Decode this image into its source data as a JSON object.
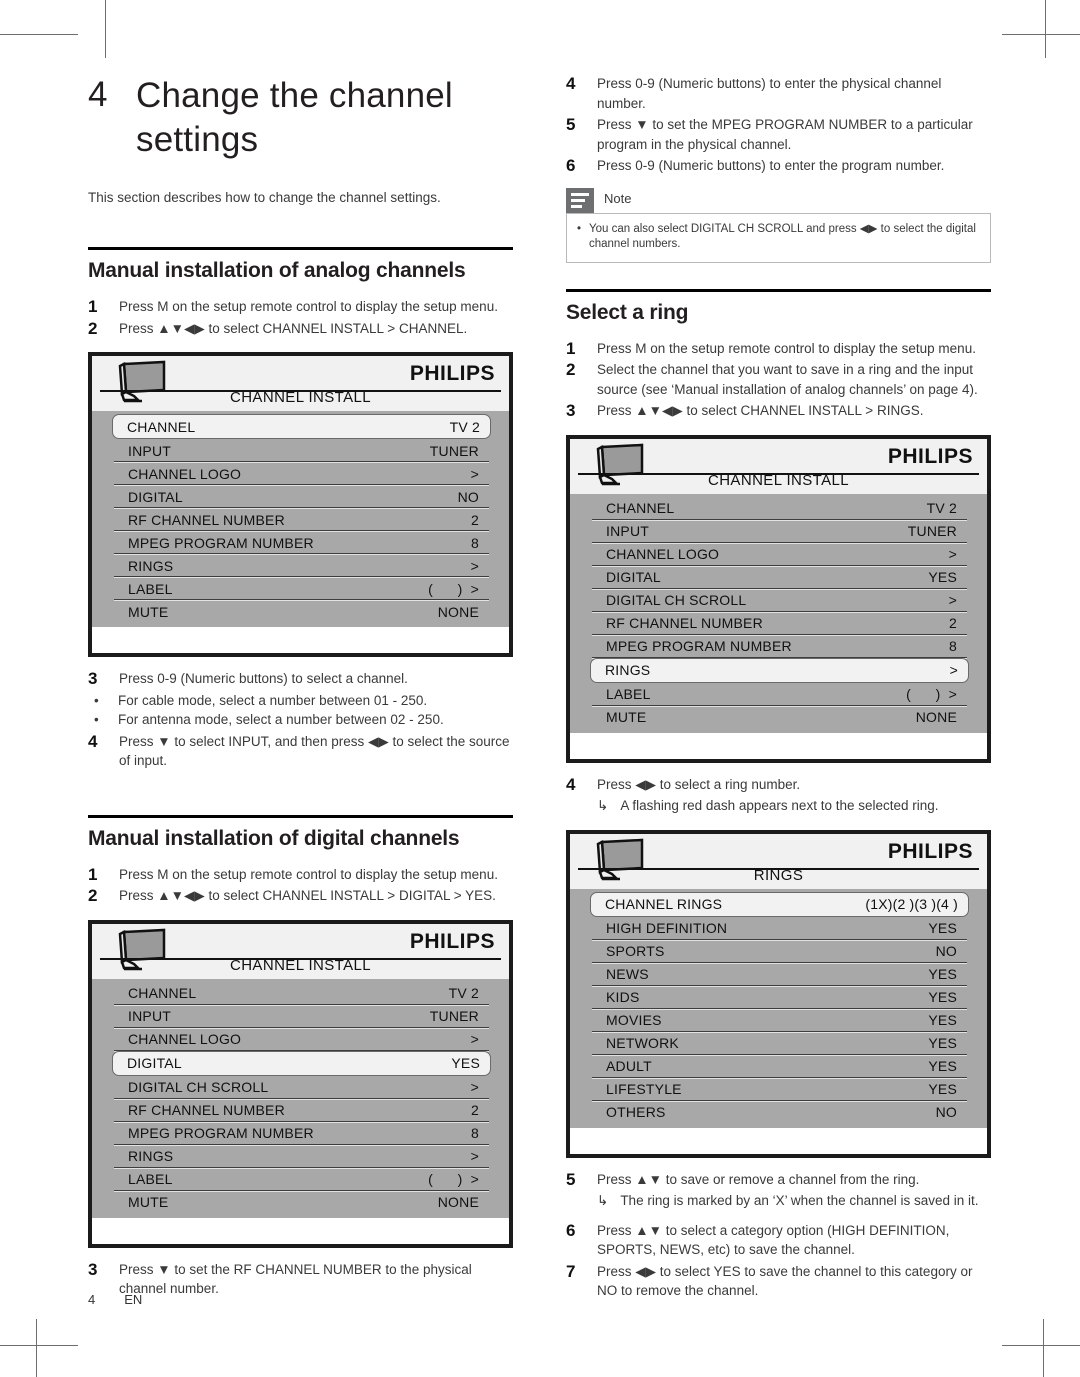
{
  "page": {
    "number": "4",
    "lang": "EN"
  },
  "chapter": {
    "number": "4",
    "title_line1": "Change the channel",
    "title_line2": "settings",
    "intro": "This section describes how to change the channel settings."
  },
  "sections": {
    "analog": {
      "title": "Manual installation of analog channels",
      "steps": [
        {
          "n": "1",
          "text": "Press M on the setup remote control to display the setup menu."
        },
        {
          "n": "2",
          "text": "Press ▲▼◀▶ to select CHANNEL INSTALL > CHANNEL."
        },
        {
          "n": "3",
          "text": "Press 0-9 (Numeric buttons) to select a channel."
        },
        {
          "n": "4",
          "text": "Press ▼ to select INPUT, and then press ◀▶ to select the source of input."
        }
      ],
      "bullets": [
        "For cable mode, select a number between 01 - 250.",
        "For antenna mode, select a number between 02 - 250."
      ]
    },
    "digital": {
      "title": "Manual installation of digital channels",
      "steps": [
        {
          "n": "1",
          "text": "Press M on the setup remote control to display the setup menu."
        },
        {
          "n": "2",
          "text": "Press ▲▼◀▶ to select CHANNEL INSTALL > DIGITAL > YES."
        },
        {
          "n": "3",
          "text": "Press ▼ to set the RF CHANNEL NUMBER to the physical channel number."
        },
        {
          "n": "4",
          "text": "Press 0-9 (Numeric buttons) to enter the physical channel number."
        },
        {
          "n": "5",
          "text": "Press ▼ to set the MPEG PROGRAM NUMBER to a particular program in the physical channel."
        },
        {
          "n": "6",
          "text": "Press 0-9 (Numeric buttons) to enter the program number."
        }
      ],
      "note": {
        "label": "Note",
        "bullet": "•",
        "text": "You can also select DIGITAL CH SCROLL and press ◀▶ to select the digital channel numbers."
      }
    },
    "ring": {
      "title": "Select a ring",
      "steps": [
        {
          "n": "1",
          "text": "Press M on the setup remote control to display the setup menu."
        },
        {
          "n": "2",
          "text": "Select the channel that you want to save in a ring and the input source (see ‘Manual installation of analog channels’ on page 4)."
        },
        {
          "n": "3",
          "text": "Press ▲▼◀▶ to select CHANNEL INSTALL > RINGS."
        },
        {
          "n": "4",
          "text": "Press ◀▶ to select a ring number."
        },
        {
          "n": "5",
          "text": "Press ▲▼ to save or remove a channel from the ring."
        },
        {
          "n": "6",
          "text": "Press ▲▼ to select a category option (HIGH DEFINITION, SPORTS, NEWS, etc) to save the channel."
        },
        {
          "n": "7",
          "text": "Press ◀▶ to select YES to save the channel to this category or NO to remove the channel."
        }
      ],
      "results": [
        "A flashing red dash appears next to the selected ring.",
        "The ring is marked by an ‘X’ when the channel is saved in it."
      ]
    }
  },
  "osd_menus": {
    "analog": {
      "brand": "PHILIPS",
      "title": "CHANNEL INSTALL",
      "rows": [
        {
          "label": "CHANNEL",
          "value": "TV 2",
          "selected": true
        },
        {
          "label": "INPUT",
          "value": "TUNER",
          "selected": false
        },
        {
          "label": "CHANNEL LOGO",
          "value": ">",
          "selected": false
        },
        {
          "label": "DIGITAL",
          "value": "NO",
          "selected": false
        },
        {
          "label": "RF CHANNEL NUMBER",
          "value": "2",
          "selected": false
        },
        {
          "label": "MPEG PROGRAM NUMBER",
          "value": "8",
          "selected": false
        },
        {
          "label": "RINGS",
          "value": ">",
          "selected": false
        },
        {
          "label": "LABEL",
          "value": "(      )  >",
          "selected": false
        },
        {
          "label": "MUTE",
          "value": "NONE",
          "selected": false
        }
      ]
    },
    "digital": {
      "brand": "PHILIPS",
      "title": "CHANNEL INSTALL",
      "rows": [
        {
          "label": "CHANNEL",
          "value": "TV 2",
          "selected": false
        },
        {
          "label": "INPUT",
          "value": "TUNER",
          "selected": false
        },
        {
          "label": "CHANNEL LOGO",
          "value": ">",
          "selected": false
        },
        {
          "label": "DIGITAL",
          "value": "YES",
          "selected": true
        },
        {
          "label": "DIGITAL CH SCROLL",
          "value": ">",
          "selected": false
        },
        {
          "label": "RF CHANNEL NUMBER",
          "value": "2",
          "selected": false
        },
        {
          "label": "MPEG PROGRAM NUMBER",
          "value": "8",
          "selected": false
        },
        {
          "label": "RINGS",
          "value": ">",
          "selected": false
        },
        {
          "label": "LABEL",
          "value": "(      )  >",
          "selected": false
        },
        {
          "label": "MUTE",
          "value": "NONE",
          "selected": false
        }
      ]
    },
    "rings_parent": {
      "brand": "PHILIPS",
      "title": "CHANNEL INSTALL",
      "rows": [
        {
          "label": "CHANNEL",
          "value": "TV 2",
          "selected": false
        },
        {
          "label": "INPUT",
          "value": "TUNER",
          "selected": false
        },
        {
          "label": "CHANNEL LOGO",
          "value": ">",
          "selected": false
        },
        {
          "label": "DIGITAL",
          "value": "YES",
          "selected": false
        },
        {
          "label": "DIGITAL CH SCROLL",
          "value": ">",
          "selected": false
        },
        {
          "label": "RF CHANNEL NUMBER",
          "value": "2",
          "selected": false
        },
        {
          "label": "MPEG PROGRAM NUMBER",
          "value": "8",
          "selected": false
        },
        {
          "label": "RINGS",
          "value": ">",
          "selected": true
        },
        {
          "label": "LABEL",
          "value": "(      )  >",
          "selected": false
        },
        {
          "label": "MUTE",
          "value": "NONE",
          "selected": false
        }
      ]
    },
    "rings": {
      "brand": "PHILIPS",
      "title": "RINGS",
      "rows": [
        {
          "label": "CHANNEL RINGS",
          "value": "(1X)(2 )(3 )(4 )",
          "selected": true
        },
        {
          "label": "HIGH DEFINITION",
          "value": "YES",
          "selected": false
        },
        {
          "label": "SPORTS",
          "value": "NO",
          "selected": false
        },
        {
          "label": "NEWS",
          "value": "YES",
          "selected": false
        },
        {
          "label": "KIDS",
          "value": "YES",
          "selected": false
        },
        {
          "label": "MOVIES",
          "value": "YES",
          "selected": false
        },
        {
          "label": "NETWORK",
          "value": "YES",
          "selected": false
        },
        {
          "label": "ADULT",
          "value": "YES",
          "selected": false
        },
        {
          "label": "LIFESTYLE",
          "value": "YES",
          "selected": false
        },
        {
          "label": "OTHERS",
          "value": "NO",
          "selected": false
        }
      ]
    }
  }
}
